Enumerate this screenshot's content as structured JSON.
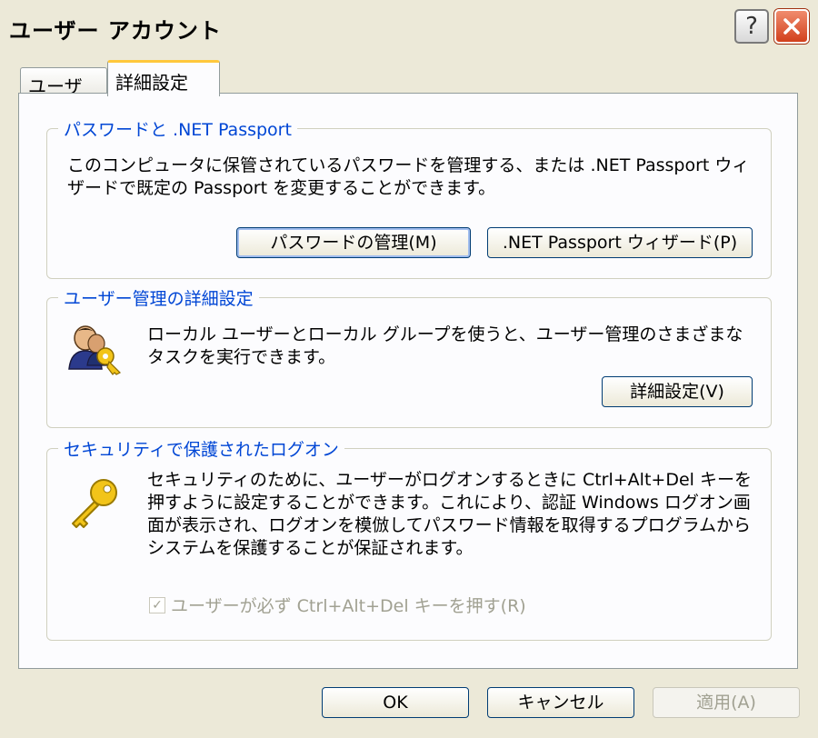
{
  "window": {
    "title": "ユーザー アカウント",
    "help_glyph": "?"
  },
  "tabs": [
    {
      "label": "ユーザー"
    },
    {
      "label": "詳細設定"
    }
  ],
  "passport_group": {
    "legend": "パスワードと .NET Passport",
    "description": "このコンピュータに保管されているパスワードを管理する、または .NET Passport ウィザードで既定の Passport を変更することができます。",
    "manage_button": "パスワードの管理(M)",
    "wizard_button": ".NET Passport ウィザード(P)"
  },
  "user_mgmt_group": {
    "legend": "ユーザー管理の詳細設定",
    "description": "ローカル ユーザーとローカル グループを使うと、ユーザー管理のさまざまなタスクを実行できます。",
    "advanced_button": "詳細設定(V)",
    "icon": "users-key-icon"
  },
  "secure_logon_group": {
    "legend": "セキュリティで保護されたログオン",
    "description": "セキュリティのために、ユーザーがログオンするときに Ctrl+Alt+Del キーを押すように設定することができます。これにより、認証 Windows ログオン画面が表示され、ログオンを模倣してパスワード情報を取得するプログラムからシステムを保護することが保証されます。",
    "checkbox_label": "ユーザーが必ず Ctrl+Alt+Del キーを押す(R)",
    "checkbox_checked": true,
    "icon": "key-icon"
  },
  "footer": {
    "ok": "OK",
    "cancel": "キャンセル",
    "apply": "適用(A)"
  }
}
